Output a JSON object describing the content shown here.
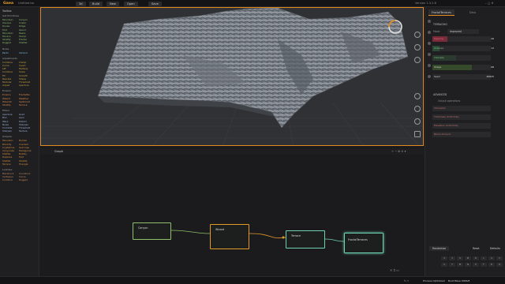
{
  "app": {
    "logo": "Gaea",
    "file": "Untitled.tor",
    "menus": [
      "3d",
      "Build",
      "New",
      "Open",
      "Save"
    ],
    "version": "Version 1.3.2.6"
  },
  "sidebar": {
    "title": "Toolbox",
    "categories": [
      {
        "label": "Get Primitives",
        "items": [
          "Mountain",
          "Canyon",
          "Volcano",
          "Crater",
          "Dunes",
          "Ridge",
          "Fold",
          "Island",
          "Mountain",
          "Peaks",
          "Terrace",
          "Slump",
          "Stratify",
          "Fractal",
          "Rugged",
          "Shatter"
        ]
      },
      {
        "label": "Noise",
        "items": [
          "Perlin",
          "Voronoi"
        ]
      },
      {
        "label": "Adjustments",
        "items": [
          "Combine",
          "Clamp",
          "Curve",
          "Invert",
          "Lift",
          "Multiply",
          "Combine",
          "Scale",
          "Fill",
          "Smooth",
          "Rescale",
          "Shape",
          "Modular",
          "Threshold",
          "Adjust",
          "Aperture"
        ]
      },
      {
        "label": "Erosion",
        "items": [
          "Erosion",
          "FractalTer",
          "Wizard",
          "Weather",
          "Wizard2",
          "Sediment",
          "Stratify",
          "Terrace"
        ]
      },
      {
        "label": "Filters",
        "items": [
          "Aperture",
          "Grad",
          "Blur",
          "Lens",
          "Warp",
          "Distort",
          "Noise",
          "Sharpen",
          "Crumble",
          "Threshold",
          "Sharpen",
          "Texture"
        ]
      },
      {
        "label": "Outputs",
        "items": [
          "Mountain",
          "Bombs",
          "Blockify",
          "Cracked",
          "Crystalline",
          "Outcrops",
          "Canyonize",
          "Hexagonal",
          "Shatter",
          "Bubbly",
          "Displace",
          "Fold",
          "Shatter",
          "Stratify",
          "Terrace",
          "Triangle"
        ]
      },
      {
        "label": "Lookdev",
        "items": [
          "Blendrock",
          "Curvature",
          "Cartesian",
          "Carve",
          "Combine",
          "Rugged"
        ]
      }
    ]
  },
  "viewport": {
    "label": "Rendering"
  },
  "graph": {
    "title": "Graph",
    "nodes": [
      {
        "label": "Canyon",
        "color": "#8fbf6a"
      },
      {
        "label": "Wizard",
        "color": "#e09a2a"
      },
      {
        "label": "Terrace",
        "color": "#6fd0b0"
      },
      {
        "label": "FractalTerraces",
        "color": "#6fd0b0"
      }
    ]
  },
  "properties": {
    "tabs": [
      "FractalTerraces",
      "Data"
    ],
    "section": "TERRACING",
    "mode_label": "Mode",
    "mode_value": "Improved",
    "props": [
      {
        "label": "Spacing",
        "value": "26",
        "fill": 0.26,
        "color": "#7a2b3a"
      },
      {
        "label": "Octaves",
        "value": "12",
        "fill": 0.12,
        "color": "#2a4a35"
      },
      {
        "label": "Intensity",
        "value": "",
        "fill": 0.4,
        "color": "#2b3a2e"
      },
      {
        "label": "Shape",
        "value": "68",
        "fill": 0.68,
        "color": "#344a2a"
      },
      {
        "label": "Seed",
        "value": "40625",
        "fill": 0.0,
        "color": "#2a2a2d"
      }
    ],
    "advanced_label": "ADVANCED",
    "advanced_sub": "Output operations",
    "advanced_props": [
      "Character",
      "Thickness Uniformity",
      "Elevation Uniformity",
      "Blend Amount"
    ],
    "footer_buttons": [
      "Randomize",
      "Reset",
      "Defaults"
    ],
    "keys": [
      "4",
      "3",
      "6",
      "W",
      "D",
      "L",
      "S",
      "C",
      "A",
      "T",
      "M",
      "N",
      "P",
      "F",
      "R",
      "O"
    ]
  },
  "status": {
    "text": "Process Optimized",
    "memory": "Build Base 4096/8"
  }
}
